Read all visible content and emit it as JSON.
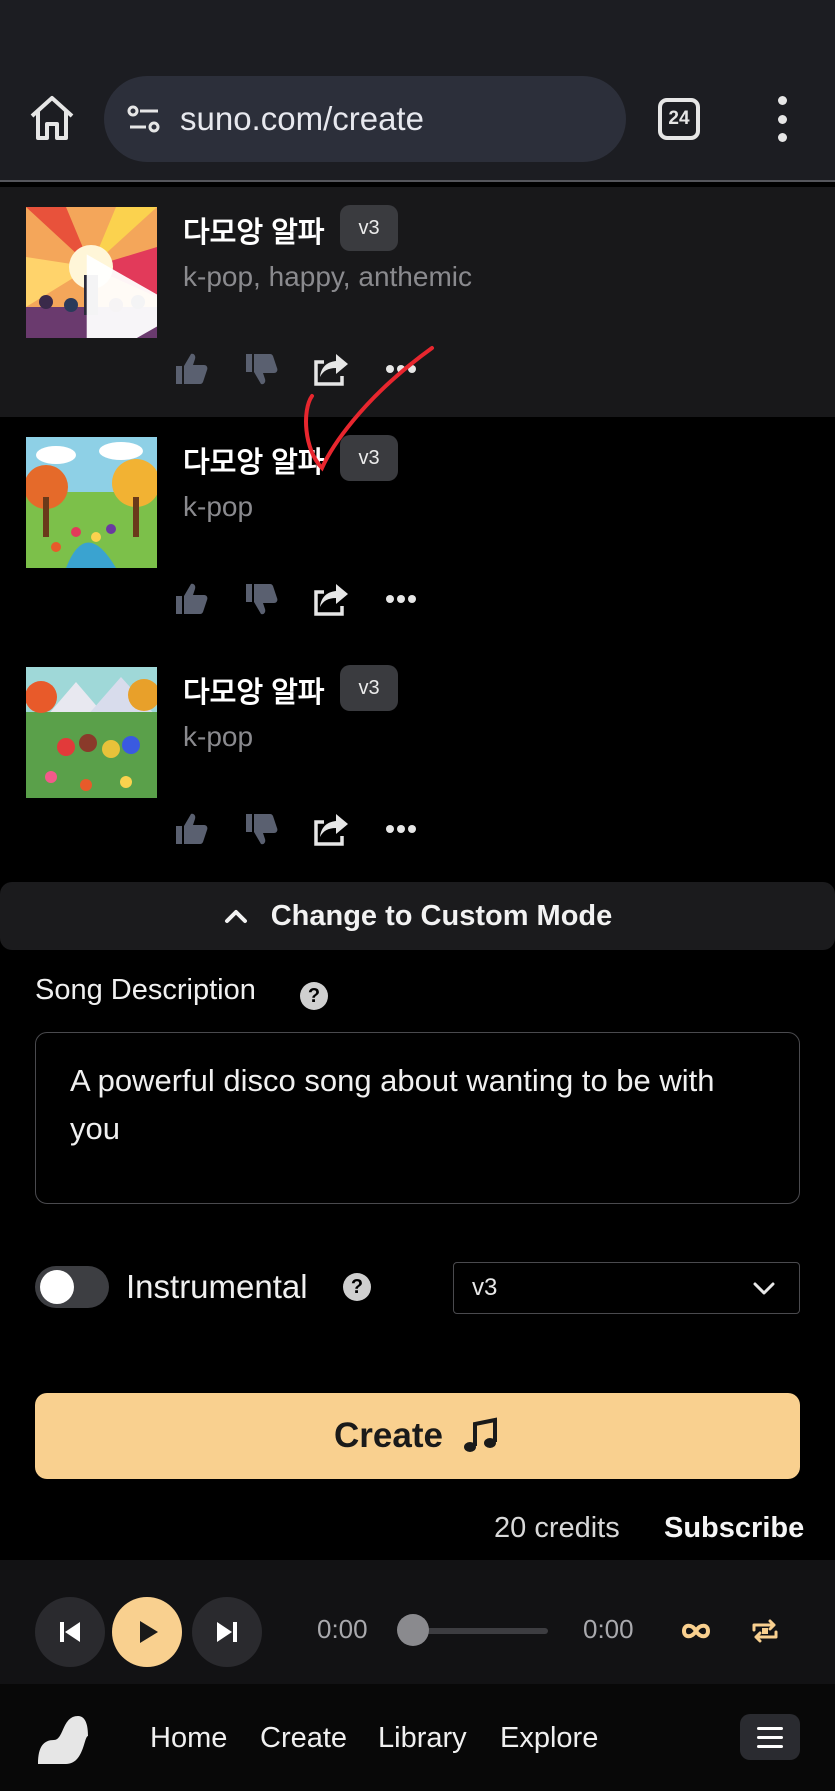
{
  "browser": {
    "url": "suno.com/create",
    "tab_count": "24"
  },
  "songs": [
    {
      "title": "다모앙 알파",
      "version": "v3",
      "tags": "k-pop, happy, anthemic"
    },
    {
      "title": "다모앙 알파",
      "version": "v3",
      "tags": "k-pop"
    },
    {
      "title": "다모앙 알파",
      "version": "v3",
      "tags": "k-pop"
    }
  ],
  "custom_mode": {
    "label": "Change to Custom Mode"
  },
  "form": {
    "description_label": "Song Description",
    "description_value": "A powerful disco song about wanting to be with you",
    "instrumental_label": "Instrumental",
    "instrumental_on": false,
    "model_selected": "v3",
    "create_label": "Create",
    "credits": "20 credits",
    "subscribe": "Subscribe"
  },
  "player": {
    "elapsed": "0:00",
    "duration": "0:00",
    "progress": 0
  },
  "nav": {
    "items": [
      "Home",
      "Create",
      "Library",
      "Explore"
    ]
  },
  "colors": {
    "accent": "#f9d08f",
    "background": "#000000",
    "annotation": "#e8262e"
  }
}
